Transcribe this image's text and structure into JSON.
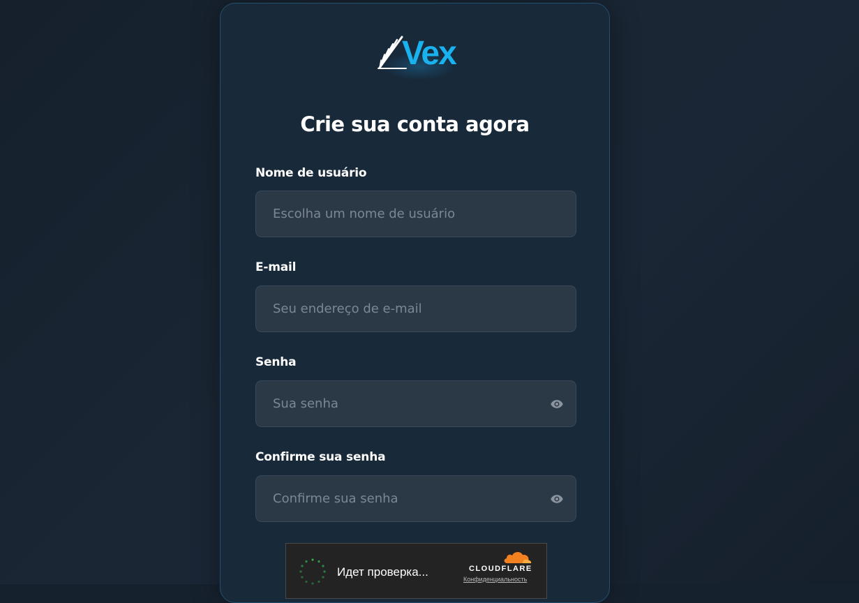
{
  "brand": {
    "name": "Vex",
    "accent": "#1ab2ee"
  },
  "form": {
    "title": "Crie sua conta agora",
    "fields": [
      {
        "label": "Nome de usuário",
        "placeholder": "Escolha um nome de usuário",
        "value": "",
        "type": "text",
        "icon": null
      },
      {
        "label": "E-mail",
        "placeholder": "Seu endereço de e-mail",
        "value": "",
        "type": "email",
        "icon": null
      },
      {
        "label": "Senha",
        "placeholder": "Sua senha",
        "value": "",
        "type": "password",
        "icon": "eye-icon"
      },
      {
        "label": "Confirme sua senha",
        "placeholder": "Confirme sua senha",
        "value": "",
        "type": "password",
        "icon": "eye-icon"
      }
    ]
  },
  "captcha": {
    "status": "Идет проверка...",
    "provider": "CLOUDFLARE",
    "privacy_link": "Конфиденциальность",
    "icon": "cloudflare-cloud-icon",
    "spinner_color": "#2fa84f"
  },
  "colors": {
    "background": "#16212e",
    "card": "#18293a",
    "card_border": "#24506f",
    "input_bg": "#2b3947"
  }
}
